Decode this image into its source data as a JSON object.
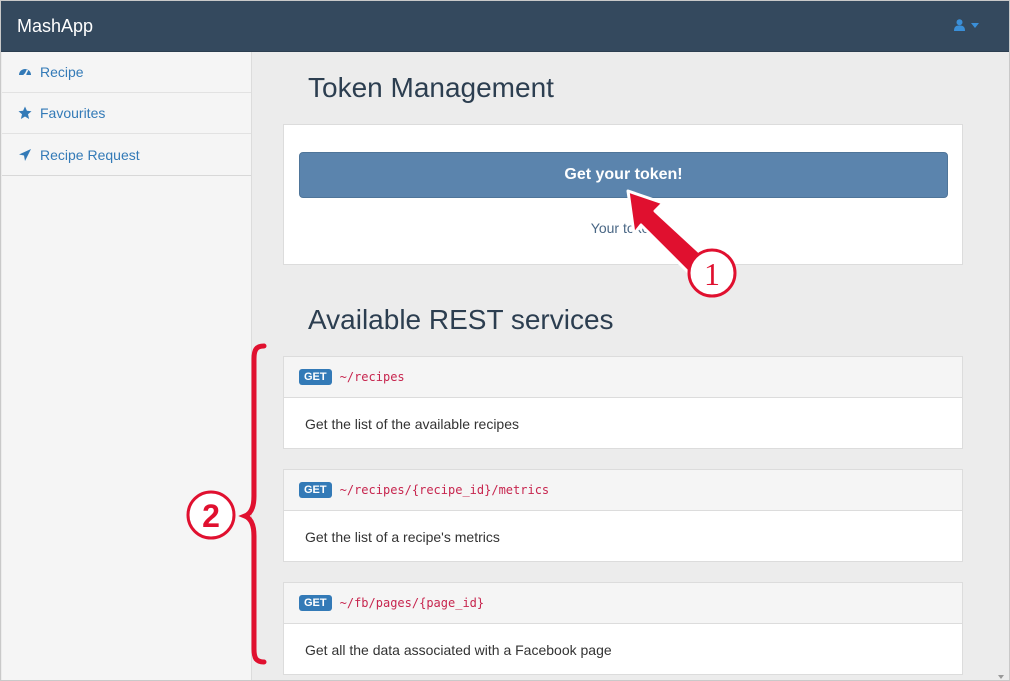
{
  "navbar": {
    "brand": "MashApp",
    "user_icon": "user-icon",
    "caret_icon": "caret-down-icon"
  },
  "sidebar": {
    "items": [
      {
        "label": "Recipe",
        "icon": "dashboard-icon"
      },
      {
        "label": "Favourites",
        "icon": "star-icon"
      },
      {
        "label": "Recipe Request",
        "icon": "paper-plane-icon"
      }
    ]
  },
  "main": {
    "token_title": "Token Management",
    "token_button": "Get your token!",
    "token_text": "Your token",
    "rest_title": "Available REST services",
    "services": [
      {
        "method": "GET",
        "endpoint": "~/recipes",
        "description": "Get the list of the available recipes"
      },
      {
        "method": "GET",
        "endpoint": "~/recipes/{recipe_id}/metrics",
        "description": "Get the list of a recipe's metrics"
      },
      {
        "method": "GET",
        "endpoint": "~/fb/pages/{page_id}",
        "description": "Get all the data associated with a Facebook page"
      }
    ]
  },
  "annotations": {
    "marker_1": "1",
    "marker_2": "2",
    "color": "#e0102f"
  },
  "colors": {
    "navbar": "#34495e",
    "button": "#5b84ad",
    "link": "#337ab7",
    "badge": "#337ab7",
    "endpoint": "#c7254e"
  }
}
